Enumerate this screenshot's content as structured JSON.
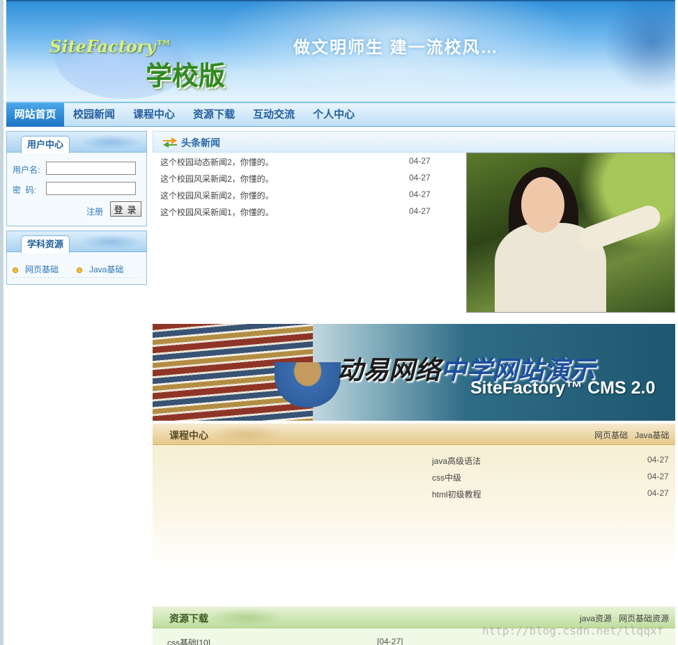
{
  "header": {
    "brand_en": "SiteFactory™",
    "brand_cn": "学校版",
    "slogan": "做文明师生  建一流校风…"
  },
  "nav": {
    "items": [
      {
        "label": "网站首页"
      },
      {
        "label": "校园新闻"
      },
      {
        "label": "课程中心"
      },
      {
        "label": "资源下载"
      },
      {
        "label": "互动交流"
      },
      {
        "label": "个人中心"
      }
    ]
  },
  "user_center": {
    "title": "用户中心",
    "username_label": "用户名:",
    "password_label": "密  码:",
    "username_value": "",
    "password_value": "",
    "register_label": "注册",
    "login_label": "登录"
  },
  "subject_resources": {
    "title": "学科资源",
    "items": [
      {
        "label": "网页基础"
      },
      {
        "label": "Java基础"
      }
    ]
  },
  "headline_news": {
    "title": "头条新闻",
    "items": [
      {
        "title": "这个校园动态新闻2，你懂的。",
        "date": "04-27"
      },
      {
        "title": "这个校园风采新闻2，你懂的。",
        "date": "04-27"
      },
      {
        "title": "这个校园风采新闻2，你懂的。",
        "date": "04-27"
      },
      {
        "title": "这个校园风采新闻1，你懂的。",
        "date": "04-27"
      }
    ]
  },
  "promo": {
    "line1_a": "动易网络",
    "line1_b": "中学网站演示",
    "line2": "SiteFactory™ CMS 2.0"
  },
  "course_center": {
    "title": "课程中心",
    "links": [
      {
        "label": "网页基础"
      },
      {
        "label": "Java基础"
      }
    ],
    "items": [
      {
        "title": "java高级语法",
        "date": "04-27"
      },
      {
        "title": "css中级",
        "date": "04-27"
      },
      {
        "title": "html初级教程",
        "date": "04-27"
      }
    ]
  },
  "resource_download": {
    "title": "资源下载",
    "links": [
      {
        "label": "java资源"
      },
      {
        "label": "网页基础资源"
      }
    ],
    "items": [
      {
        "title": "css基础[10]",
        "date": "[04-27]"
      }
    ]
  },
  "watermark": "http://blog.csdn.net/llqqxf"
}
